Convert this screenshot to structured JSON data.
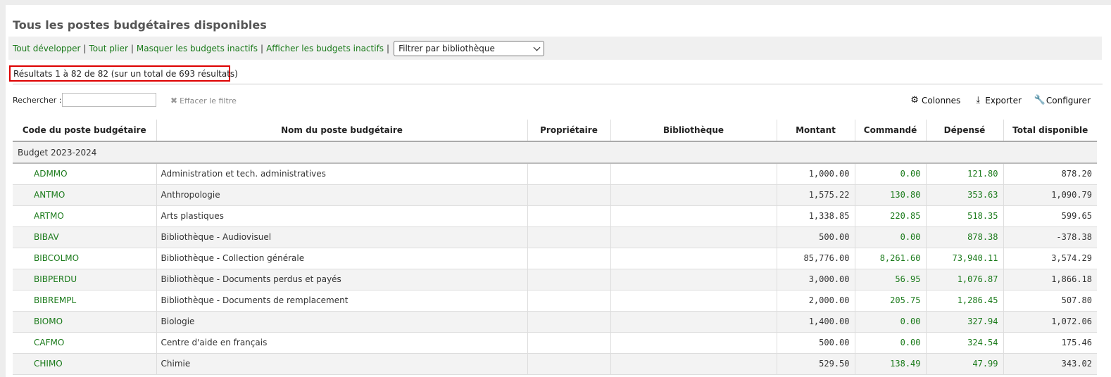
{
  "page_title": "Tous les postes budgétaires disponibles",
  "toolbar": {
    "links": [
      "Tout développer",
      "Tout plier",
      "Masquer les budgets inactifs",
      "Afficher les budgets inactifs"
    ],
    "library_filter": "Filtrer par bibliothèque"
  },
  "results_text": "Résultats 1 à 82 de 82 (sur un total de 693 résultats)",
  "search": {
    "label": "Rechercher :",
    "value": "",
    "clear_label": "Effacer le filtre"
  },
  "tools": {
    "columns": "Colonnes",
    "export": "Exporter",
    "configure": "Configurer"
  },
  "table": {
    "headers": [
      "Code du poste budgétaire",
      "Nom du poste budgétaire",
      "Propriétaire",
      "Bibliothèque",
      "Montant",
      "Commandé",
      "Dépensé",
      "Total disponible"
    ],
    "group": "Budget 2023-2024",
    "rows": [
      {
        "code": "ADMMO",
        "name": "Administration et tech. administratives",
        "owner": "",
        "library": "",
        "amount": "1,000.00",
        "ordered": "0.00",
        "spent": "121.80",
        "available": "878.20"
      },
      {
        "code": "ANTMO",
        "name": "Anthropologie",
        "owner": "",
        "library": "",
        "amount": "1,575.22",
        "ordered": "130.80",
        "spent": "353.63",
        "available": "1,090.79"
      },
      {
        "code": "ARTMO",
        "name": "Arts plastiques",
        "owner": "",
        "library": "",
        "amount": "1,338.85",
        "ordered": "220.85",
        "spent": "518.35",
        "available": "599.65"
      },
      {
        "code": "BIBAV",
        "name": "Bibliothèque - Audiovisuel",
        "owner": "",
        "library": "",
        "amount": "500.00",
        "ordered": "0.00",
        "spent": "878.38",
        "available": "-378.38"
      },
      {
        "code": "BIBCOLMO",
        "name": "Bibliothèque - Collection générale",
        "owner": "",
        "library": "",
        "amount": "85,776.00",
        "ordered": "8,261.60",
        "spent": "73,940.11",
        "available": "3,574.29"
      },
      {
        "code": "BIBPERDU",
        "name": "Bibliothèque - Documents perdus et payés",
        "owner": "",
        "library": "",
        "amount": "3,000.00",
        "ordered": "56.95",
        "spent": "1,076.87",
        "available": "1,866.18"
      },
      {
        "code": "BIBREMPL",
        "name": "Bibliothèque - Documents de remplacement",
        "owner": "",
        "library": "",
        "amount": "2,000.00",
        "ordered": "205.75",
        "spent": "1,286.45",
        "available": "507.80"
      },
      {
        "code": "BIOMO",
        "name": "Biologie",
        "owner": "",
        "library": "",
        "amount": "1,400.00",
        "ordered": "0.00",
        "spent": "327.94",
        "available": "1,072.06"
      },
      {
        "code": "CAFMO",
        "name": "Centre d'aide en français",
        "owner": "",
        "library": "",
        "amount": "500.00",
        "ordered": "0.00",
        "spent": "324.54",
        "available": "175.46"
      },
      {
        "code": "CHIMO",
        "name": "Chimie",
        "owner": "",
        "library": "",
        "amount": "529.50",
        "ordered": "138.49",
        "spent": "47.99",
        "available": "343.02"
      }
    ]
  },
  "colors": {
    "link": "#1a7a1a",
    "highlight_border": "#dd0000"
  },
  "icons": {
    "columns": "gear-icon",
    "export": "download-icon",
    "configure": "wrench-icon",
    "clear": "close-icon"
  }
}
